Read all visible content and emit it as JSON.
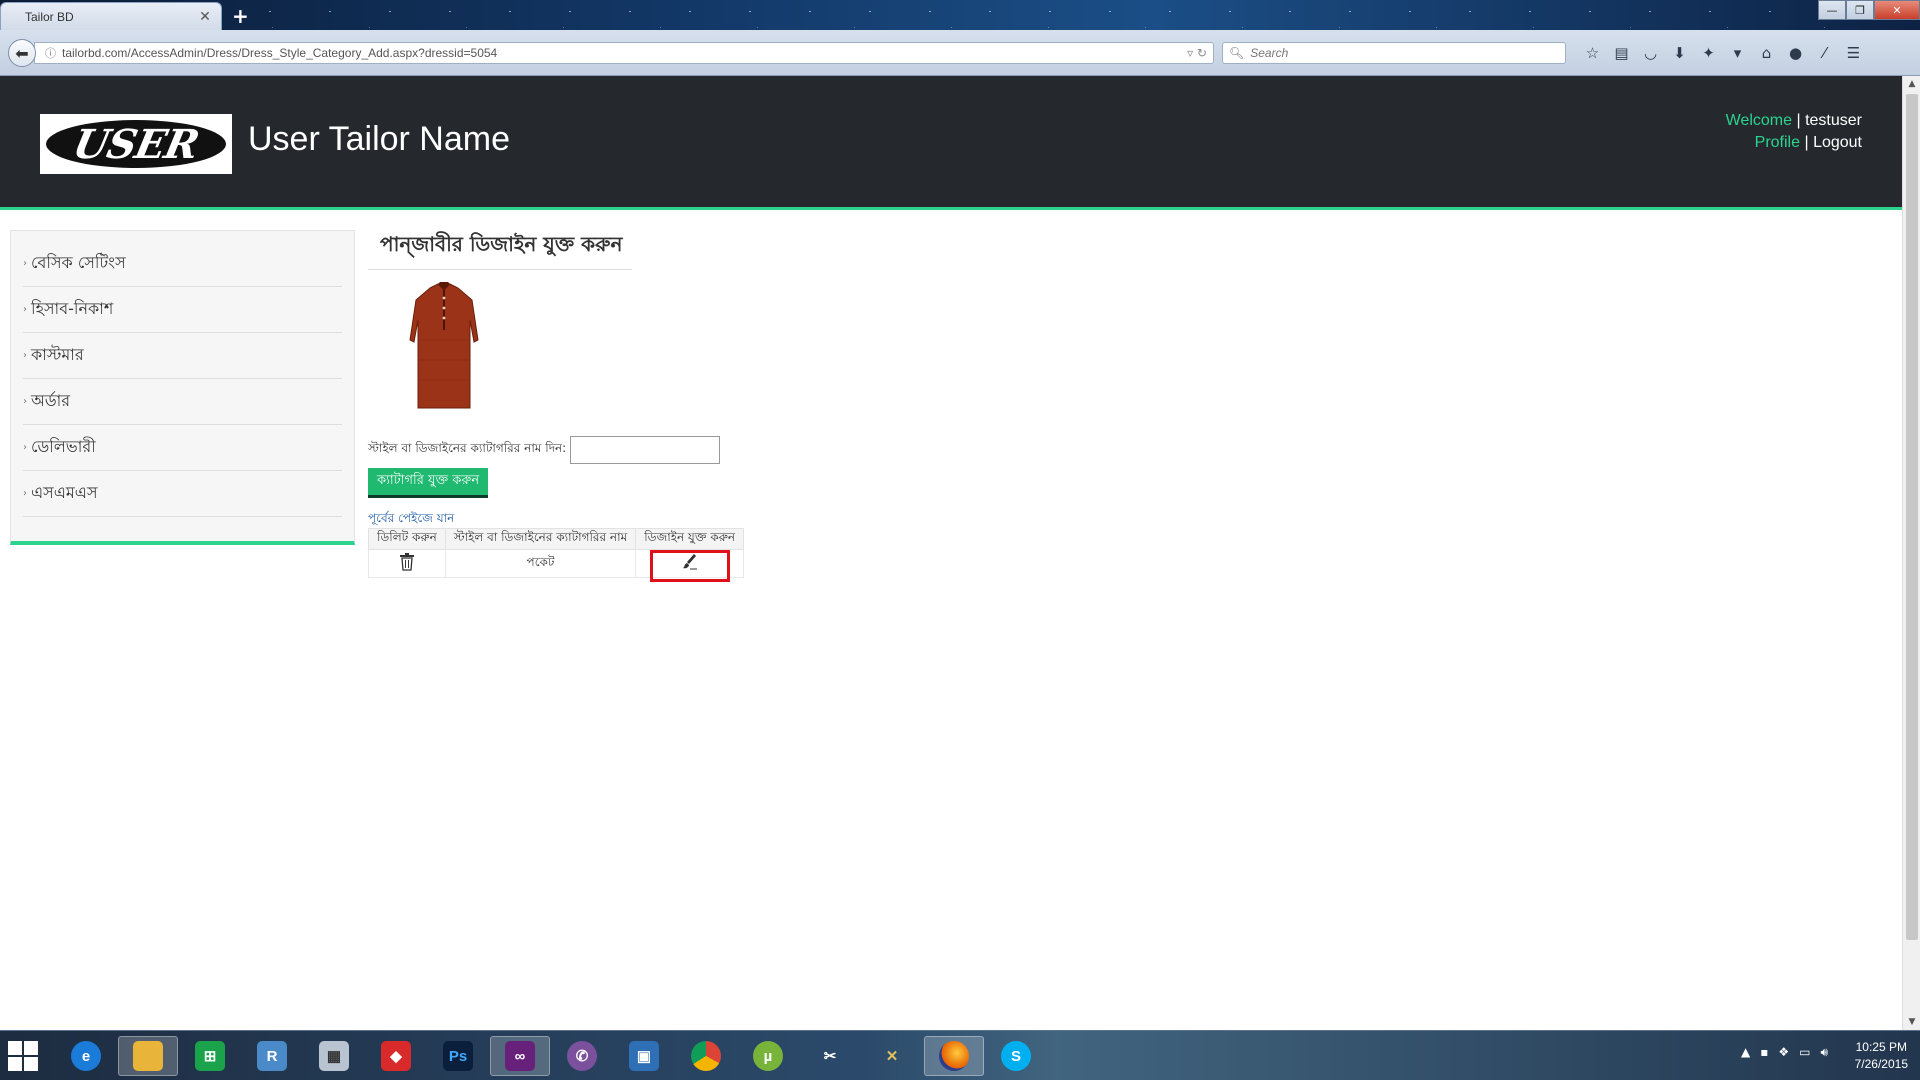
{
  "browser": {
    "tab_title": "Tailor BD",
    "tab_close": "✕",
    "new_tab": "+",
    "url": "tailorbd.com/AccessAdmin/Dress/Dress_Style_Category_Add.aspx?dressid=5054",
    "search_placeholder": "Search",
    "window_controls": {
      "minimize": "—",
      "restore": "❐",
      "close": "✕"
    }
  },
  "header": {
    "logo_text": "USER",
    "site_title": "User Tailor Name",
    "welcome_label": "Welcome",
    "username": "testuser",
    "profile_label": "Profile",
    "logout_label": "Logout",
    "separator": "|"
  },
  "sidebar": {
    "items": [
      {
        "label": "বেসিক সেটিংস"
      },
      {
        "label": "হিসাব-নিকাশ"
      },
      {
        "label": "কাস্টমার"
      },
      {
        "label": "অর্ডার"
      },
      {
        "label": "ডেলিভারী"
      },
      {
        "label": "এসএমএস"
      }
    ]
  },
  "main": {
    "page_title": "পান্জাবীর ডিজাইন যুক্ত করুন",
    "form_label": "স্টাইল বা ডিজাইনের ক্যাটাগরির নাম দিন:",
    "category_input_value": "",
    "add_button_label": "ক্যাটাগরি যুক্ত করুন",
    "back_link_label": "পূর্বের পেইজে যান",
    "table": {
      "headers": [
        "ডিলিট করুন",
        "স্টাইল বা ডিজাইনের ক্যাটাগরির নাম",
        "ডিজাইন যুক্ত করুন"
      ],
      "rows": [
        {
          "category_name": "পকেট"
        }
      ]
    }
  },
  "taskbar": {
    "clock_time": "10:25 PM",
    "clock_date": "7/26/2015",
    "icons": [
      "start-icon",
      "internet-explorer-icon",
      "file-explorer-icon",
      "store-icon",
      "reader-icon",
      "calculator-icon",
      "solitaire-icon",
      "photoshop-icon",
      "visual-studio-icon",
      "viber-icon",
      "network-icon",
      "chrome-icon",
      "utorrent-icon",
      "badminton-icon",
      "tools-icon",
      "firefox-icon",
      "skype-icon"
    ],
    "photoshop_label": "Ps",
    "store_label": "⊞"
  },
  "colors": {
    "accent_green": "#2bd38e",
    "button_green": "#1fb970",
    "header_bg": "#25292e",
    "highlight_red": "#e0101a"
  }
}
